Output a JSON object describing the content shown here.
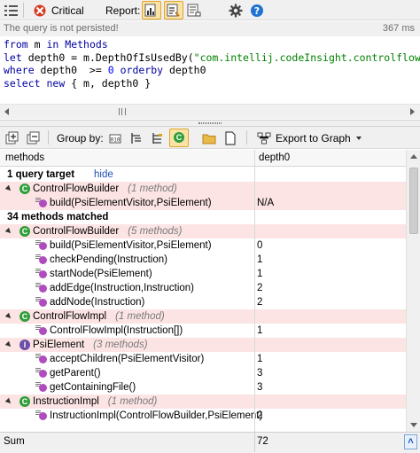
{
  "toolbar": {
    "severity_label": "Critical",
    "report_label": "Report:",
    "icons": [
      "list-icon",
      "severity-icon",
      "report-table-icon",
      "report-graph-icon",
      "report-export-icon",
      "settings-icon",
      "help-icon"
    ]
  },
  "status": {
    "message": "The query is not persisted!",
    "time": "367 ms"
  },
  "query": {
    "lines": [
      [
        {
          "t": "from",
          "c": "kw"
        },
        {
          "t": " m "
        },
        {
          "t": "in",
          "c": "kw"
        },
        {
          "t": " "
        },
        {
          "t": "Methods",
          "c": "kw"
        }
      ],
      [
        {
          "t": "let",
          "c": "kw"
        },
        {
          "t": " depth0 = m.DepthOfIsUsedBy("
        },
        {
          "t": "\"com.intellij.codeInsight.controlflow",
          "c": "str"
        }
      ],
      [
        {
          "t": "where",
          "c": "kw"
        },
        {
          "t": " depth0  >= "
        },
        {
          "t": "0",
          "c": "num"
        },
        {
          "t": " "
        },
        {
          "t": "orderby",
          "c": "kw"
        },
        {
          "t": " depth0"
        }
      ],
      [
        {
          "t": "select",
          "c": "kw"
        },
        {
          "t": " "
        },
        {
          "t": "new",
          "c": "kw"
        },
        {
          "t": " { m, depth0 }"
        }
      ]
    ]
  },
  "results_toolbar": {
    "group_by_label": "Group by:",
    "export_label": "Export to Graph"
  },
  "table": {
    "columns": [
      "methods",
      "depth0"
    ],
    "rows": [
      {
        "kind": "section",
        "text": "1 query target",
        "link": "hide",
        "pink": false
      },
      {
        "kind": "type",
        "icon": "class",
        "name": "ControlFlowBuilder",
        "count": "(1 method)",
        "pink": true
      },
      {
        "kind": "method",
        "name": "build(PsiElementVisitor,PsiElement)",
        "value": "N/A",
        "pink": true
      },
      {
        "kind": "section",
        "text": "34 methods matched",
        "pink": false
      },
      {
        "kind": "type",
        "icon": "class",
        "name": "ControlFlowBuilder",
        "count": "(5 methods)",
        "pink": true
      },
      {
        "kind": "method",
        "name": "build(PsiElementVisitor,PsiElement)",
        "value": "0",
        "pink": false
      },
      {
        "kind": "method",
        "name": "checkPending(Instruction)",
        "value": "1",
        "pink": false
      },
      {
        "kind": "method",
        "name": "startNode(PsiElement)",
        "value": "1",
        "pink": false
      },
      {
        "kind": "method",
        "name": "addEdge(Instruction,Instruction)",
        "value": "2",
        "pink": false
      },
      {
        "kind": "method",
        "name": "addNode(Instruction)",
        "value": "2",
        "pink": false
      },
      {
        "kind": "type",
        "icon": "class",
        "name": "ControlFlowImpl",
        "count": "(1 method)",
        "pink": true
      },
      {
        "kind": "method",
        "name": "ControlFlowImpl(Instruction[])",
        "value": "1",
        "pink": false
      },
      {
        "kind": "type",
        "icon": "interface",
        "name": "PsiElement",
        "count": "(3 methods)",
        "pink": true
      },
      {
        "kind": "method",
        "name": "acceptChildren(PsiElementVisitor)",
        "value": "1",
        "pink": false
      },
      {
        "kind": "method",
        "name": "getParent()",
        "value": "3",
        "pink": false
      },
      {
        "kind": "method",
        "name": "getContainingFile()",
        "value": "3",
        "pink": false
      },
      {
        "kind": "type",
        "icon": "class",
        "name": "InstructionImpl",
        "count": "(1 method)",
        "pink": true
      },
      {
        "kind": "method",
        "name": "InstructionImpl(ControlFlowBuilder,PsiElement)",
        "value": "2",
        "pink": false
      }
    ],
    "footer_label": "Sum",
    "footer_value": "72"
  },
  "colors": {
    "keyword": "#0000a0",
    "string": "#008000",
    "number": "#0000ff",
    "pink_row": "#fce4e4",
    "class_icon": "#2e9e3a",
    "interface_icon": "#6b4fa8",
    "method_icon": "#b04cc0"
  }
}
